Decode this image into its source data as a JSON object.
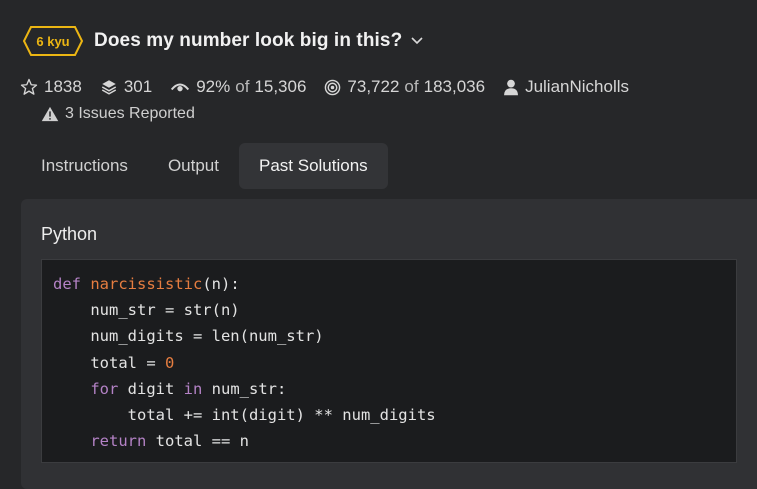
{
  "kata": {
    "rank": "6 kyu",
    "title": "Does my number look big in this?",
    "rank_color": "#ecb613"
  },
  "stats": {
    "stars": "1838",
    "collections": "301",
    "satisfaction": "92%",
    "satisfaction_of": "of",
    "votes": "15,306",
    "completed": "73,722",
    "completed_of": "of",
    "attempts": "183,036",
    "author": "JulianNicholls"
  },
  "issues": "3 Issues Reported",
  "tabs": [
    {
      "label": "Instructions",
      "active": false
    },
    {
      "label": "Output",
      "active": false
    },
    {
      "label": "Past Solutions",
      "active": true
    }
  ],
  "solution": {
    "language": "Python",
    "code_colors": {
      "keyword": "#b482c6",
      "function": "#e67d40",
      "number": "#e67d40"
    },
    "code_lines": [
      {
        "tokens": [
          {
            "t": "def",
            "c": "kw"
          },
          {
            "t": " "
          },
          {
            "t": "narcissistic",
            "c": "fn"
          },
          {
            "t": "(n):"
          }
        ]
      },
      {
        "tokens": [
          {
            "t": "    num_str = str(n)"
          }
        ]
      },
      {
        "tokens": [
          {
            "t": "    num_digits = len(num_str)"
          }
        ]
      },
      {
        "tokens": [
          {
            "t": "    total = "
          },
          {
            "t": "0",
            "c": "num"
          }
        ]
      },
      {
        "tokens": [
          {
            "t": "    "
          },
          {
            "t": "for",
            "c": "kw"
          },
          {
            "t": " digit "
          },
          {
            "t": "in",
            "c": "kw"
          },
          {
            "t": " num_str:"
          }
        ]
      },
      {
        "tokens": [
          {
            "t": "        total += int(digit) ** num_digits"
          }
        ]
      },
      {
        "tokens": [
          {
            "t": "    "
          },
          {
            "t": "return",
            "c": "kw"
          },
          {
            "t": " total == n"
          }
        ]
      }
    ]
  }
}
